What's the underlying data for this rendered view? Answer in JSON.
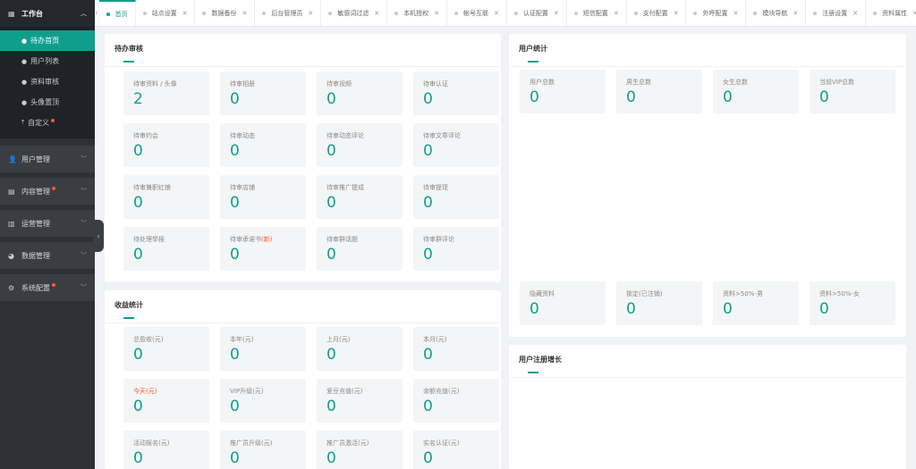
{
  "sidebar": {
    "header": {
      "label": "工作台"
    },
    "items": [
      {
        "label": "待办首页",
        "active": true
      },
      {
        "label": "用户列表"
      },
      {
        "label": "资料审核"
      },
      {
        "label": "头像置顶"
      },
      {
        "label": "自定义",
        "dot": true
      }
    ],
    "groups": [
      {
        "label": "用户管理",
        "icon": "users-icon"
      },
      {
        "label": "内容管理",
        "icon": "content-icon",
        "dot": true
      },
      {
        "label": "运营管理",
        "icon": "bar-chart-icon"
      },
      {
        "label": "数据管理",
        "icon": "pie-chart-icon"
      },
      {
        "label": "系统配置",
        "icon": "settings-icon",
        "dot": true
      }
    ]
  },
  "tabs": [
    {
      "label": "首页",
      "active": true
    },
    {
      "label": "站点设置"
    },
    {
      "label": "数据备份"
    },
    {
      "label": "后台管理员"
    },
    {
      "label": "敏感词过滤"
    },
    {
      "label": "本机授权"
    },
    {
      "label": "帐号互联"
    },
    {
      "label": "认证配置"
    },
    {
      "label": "短信配置"
    },
    {
      "label": "支付配置"
    },
    {
      "label": "外呼配置"
    },
    {
      "label": "模块导航"
    },
    {
      "label": "注册设置"
    },
    {
      "label": "资料属性"
    }
  ],
  "pending": {
    "title": "待办审核",
    "cards": [
      {
        "label": "待审资料 / 头像",
        "value": "2"
      },
      {
        "label": "待审相册",
        "value": "0"
      },
      {
        "label": "待审视频",
        "value": "0"
      },
      {
        "label": "待审认证",
        "value": "0"
      },
      {
        "label": "待审约会",
        "value": "0"
      },
      {
        "label": "待审动态",
        "value": "0"
      },
      {
        "label": "待审动态评论",
        "value": "0"
      },
      {
        "label": "待审文章评论",
        "value": "0"
      },
      {
        "label": "待审兼职红娘",
        "value": "0"
      },
      {
        "label": "待审店铺",
        "value": "0"
      },
      {
        "label": "待审推广提成",
        "value": "0"
      },
      {
        "label": "待审提现",
        "value": "0"
      },
      {
        "label": "待处理举报",
        "value": "0"
      },
      {
        "label": "待审承诺书",
        "label_new": "(新)",
        "value": "0"
      },
      {
        "label": "待审群话题",
        "value": "0"
      },
      {
        "label": "待审群评论",
        "value": "0"
      }
    ]
  },
  "income": {
    "title": "收益统计",
    "cards": [
      {
        "label": "总盈收(元)",
        "value": "0"
      },
      {
        "label": "本年(元)",
        "value": "0"
      },
      {
        "label": "上月(元)",
        "value": "0"
      },
      {
        "label": "本月(元)",
        "value": "0"
      },
      {
        "label": "今天(元)",
        "value": "0",
        "highlight": true
      },
      {
        "label": "VIP升级(元)",
        "value": "0"
      },
      {
        "label": "爱豆充值(元)",
        "value": "0"
      },
      {
        "label": "余额充值(元)",
        "value": "0"
      },
      {
        "label": "活动报名(元)",
        "value": "0"
      },
      {
        "label": "推广员升级(元)",
        "value": "0"
      },
      {
        "label": "推广员激活(元)",
        "value": "0"
      },
      {
        "label": "实名认证(元)",
        "value": "0"
      }
    ]
  },
  "user_stats": {
    "title": "用户统计",
    "top": [
      {
        "label": "用户总数",
        "value": "0"
      },
      {
        "label": "男生总数",
        "value": "0"
      },
      {
        "label": "女生总数",
        "value": "0"
      },
      {
        "label": "当前VIP总数",
        "value": "0"
      }
    ],
    "bottom": [
      {
        "label": "隐藏资料",
        "value": "0"
      },
      {
        "label": "锁定(已注销)",
        "value": "0"
      },
      {
        "label": "资料>50%-男",
        "value": "0"
      },
      {
        "label": "资料>50%-女",
        "value": "0"
      }
    ]
  },
  "growth": {
    "title": "用户注册增长"
  },
  "colors": {
    "accent": "#0e9f8c",
    "alert": "#ff5722",
    "sidebar_bg": "#2d3035"
  }
}
